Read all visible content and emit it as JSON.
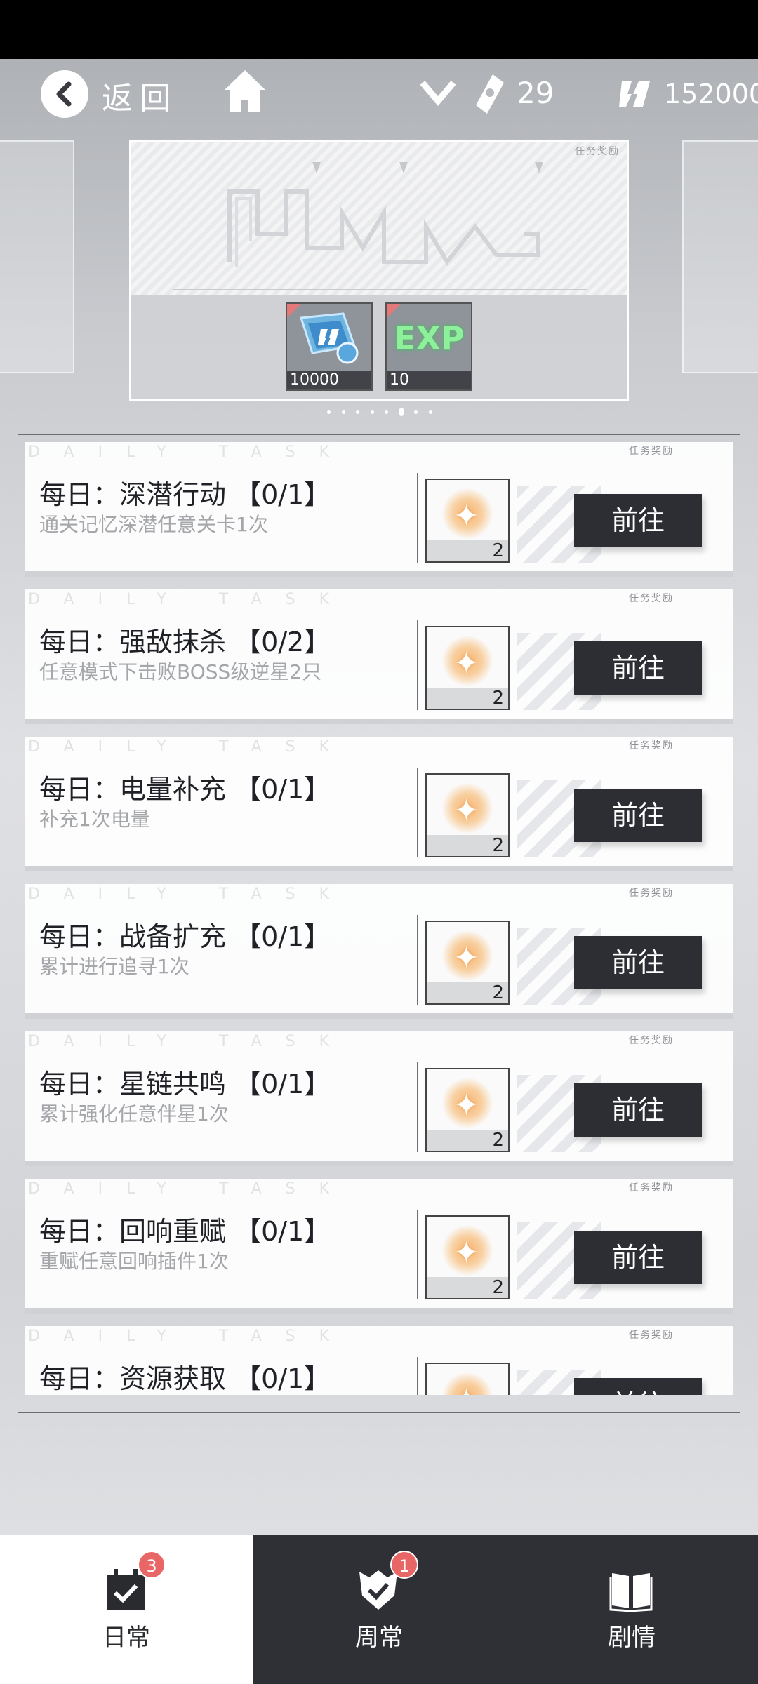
{
  "topbar": {
    "back_label": "返回",
    "ticket_count": "29",
    "coin_count": "152000"
  },
  "banner": {
    "label": "任务奖励",
    "rewards": [
      {
        "icon": "coin-crystal-icon",
        "qty": "10000"
      },
      {
        "icon": "exp-icon",
        "text": "EXP",
        "qty": "10"
      }
    ],
    "page_count": 8,
    "active_page": 5
  },
  "tasks": {
    "watermark": "DAILY TASK",
    "header": "任务奖励",
    "go_label": "前往",
    "items": [
      {
        "title": "每日：深潜行动 【0/1】",
        "desc": "通关记忆深潜任意关卡1次",
        "reward_qty": "2"
      },
      {
        "title": "每日：强敌抹杀 【0/2】",
        "desc": "任意模式下击败BOSS级逆星2只",
        "reward_qty": "2"
      },
      {
        "title": "每日：电量补充 【0/1】",
        "desc": "补充1次电量",
        "reward_qty": "2"
      },
      {
        "title": "每日：战备扩充 【0/1】",
        "desc": "累计进行追寻1次",
        "reward_qty": "2"
      },
      {
        "title": "每日：星链共鸣 【0/1】",
        "desc": "累计强化任意伴星1次",
        "reward_qty": "2"
      },
      {
        "title": "每日：回响重赋 【0/1】",
        "desc": "重赋任意回响插件1次",
        "reward_qty": "2"
      },
      {
        "title": "每日：资源获取 【0/1】",
        "desc": "",
        "reward_qty": ""
      }
    ]
  },
  "bottom_nav": {
    "tabs": [
      {
        "label": "日常",
        "badge": "3",
        "active": true
      },
      {
        "label": "周常",
        "badge": "1",
        "active": false
      },
      {
        "label": "剧情",
        "badge": "",
        "active": false
      }
    ]
  },
  "colors": {
    "button_bg": "#2c2e33",
    "badge": "#e86766",
    "reward_glow": "#f6b474"
  }
}
